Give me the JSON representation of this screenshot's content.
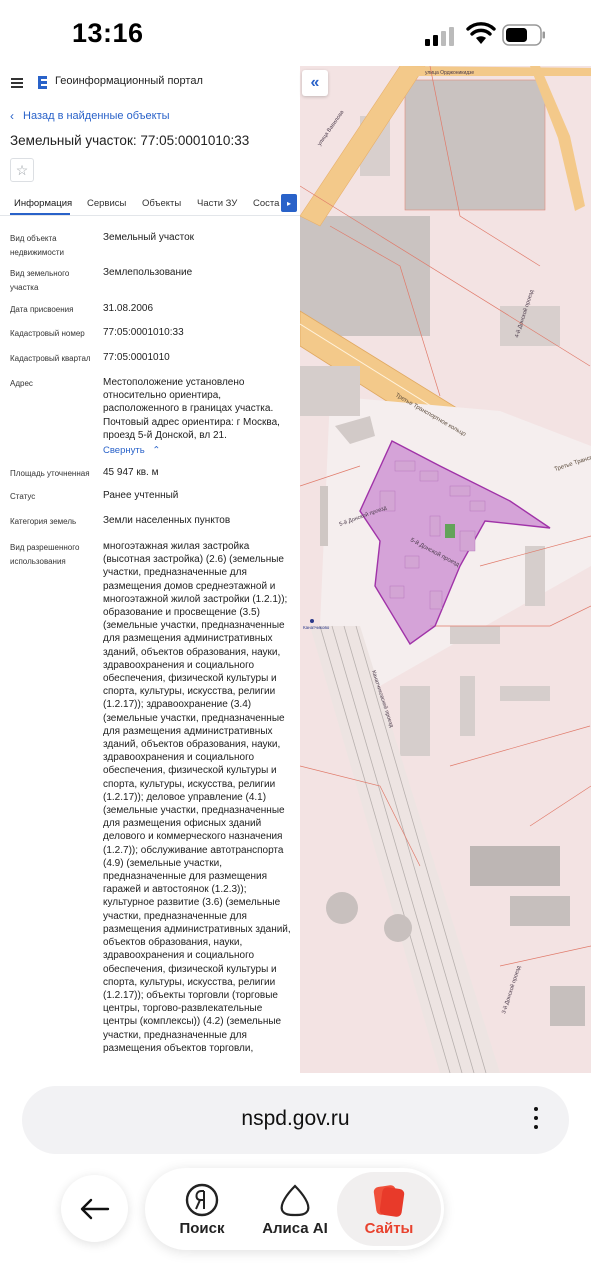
{
  "status_bar": {
    "time": "13:16"
  },
  "app": {
    "title": "Геоинформационный портал",
    "back_label": "Назад в найденные объекты",
    "page_title": "Земельный участок: 77:05:0001010:33"
  },
  "tabs": [
    "Информация",
    "Сервисы",
    "Объекты",
    "Части ЗУ",
    "Соста"
  ],
  "info": [
    {
      "label": "Вид объекта недвижимости",
      "value": "Земельный участок"
    },
    {
      "label": "Вид земельного участка",
      "value": "Землепользование"
    },
    {
      "label": "Дата присвоения",
      "value": "31.08.2006"
    },
    {
      "label": "Кадастровый номер",
      "value": "77:05:0001010:33"
    },
    {
      "label": "Кадастровый квартал",
      "value": "77:05:0001010"
    },
    {
      "label": "Адрес",
      "value": "Местоположение установлено относительно ориентира, расположенного в границах участка. Почтовый адрес ориентира: г Москва, проезд 5-й Донской, вл 21.",
      "link": "Свернуть"
    },
    {
      "label": "Площадь уточненная",
      "value": "45 947 кв. м"
    },
    {
      "label": "Статус",
      "value": "Ранее учтенный"
    },
    {
      "label": "Категория земель",
      "value": "Земли населенных пунктов"
    },
    {
      "label": "Вид разрешенного использования",
      "value": "многоэтажная жилая застройка (высотная застройка) (2.6) (земельные участки, предназначенные для размещения домов среднеэтажной и многоэтажной жилой застройки (1.2.1)); образование и просвещение (3.5) (земельные участки, предназначенные для размещения административных зданий, объектов образования, науки, здравоохранения и социального обеспечения, физической культуры и спорта, культуры, искусства, религии (1.2.17)); здравоохранение (3.4) (земельные участки, предназначенные для размещения административных зданий, объектов образования, науки, здравоохранения и социального обеспечения, физической культуры и спорта, культуры, искусства, религии (1.2.17)); деловое управление (4.1) (земельные участки, предназначенные для размещения офисных зданий делового и коммерческого назначения (1.2.7)); обслуживание автотранспорта (4.9) (земельные участки, предназначенные для размещения гаражей и автостоянок (1.2.3)); культурное развитие (3.6) (земельные участки, предназначенные для размещения административных зданий, объектов образования, науки, здравоохранения и социального обеспечения, физической культуры и спорта, культуры, искусства, религии (1.2.17)); объекты торговли (торговые центры, торгово-развлекательные центры (комплексы)) (4.2) (земельные участки, предназначенные для размещения объектов торговли,"
    }
  ],
  "map": {
    "labels": [
      "Третье Транспортное кольцо",
      "Третье Транспортное кольцо",
      "5-й Донской проезд",
      "5-й Донской проезд",
      "Канатчиковский проезд",
      "4-й Донской проезд",
      "3-й Донской проезд",
      "улица Орджоникидзе",
      "улица Вавилова",
      "Канатчиково"
    ],
    "colors": {
      "parcel": "#a033a8",
      "parcel_fill": "#c98ad0",
      "road": "#f3c98a",
      "boundary": "#e07a6a",
      "building": "#cfc7c4"
    }
  },
  "browser": {
    "url": "nspd.gov.ru",
    "nav": [
      {
        "label": "Поиск",
        "icon": "yandex-icon"
      },
      {
        "label": "Алиса AI",
        "icon": "alice-icon"
      },
      {
        "label": "Сайты",
        "icon": "sites-icon"
      }
    ]
  }
}
